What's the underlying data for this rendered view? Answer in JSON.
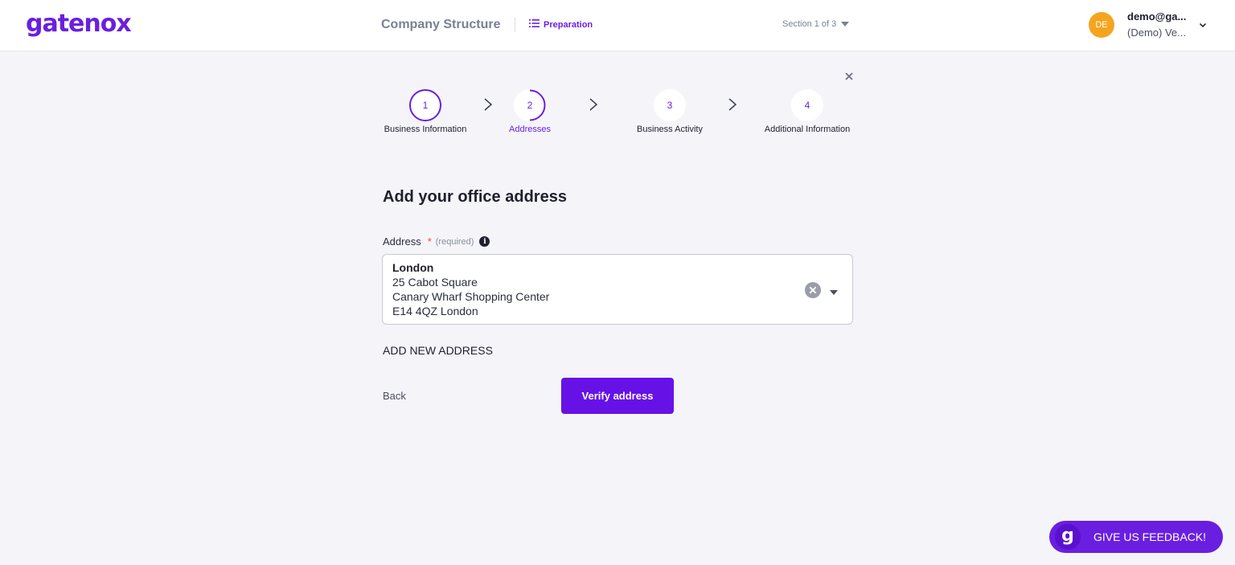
{
  "header": {
    "logo": "gatenox",
    "title": "Company Structure",
    "preparation_label": "Preparation",
    "section_label": "Section 1 of 3",
    "user": {
      "initials": "DE",
      "email": "demo@ga...",
      "org": "(Demo) Ve..."
    }
  },
  "stepper": {
    "steps": [
      {
        "number": "1",
        "label": "Business Information",
        "state": "completed"
      },
      {
        "number": "2",
        "label": "Addresses",
        "state": "active"
      },
      {
        "number": "3",
        "label": "Business Activity",
        "state": "upcoming"
      },
      {
        "number": "4",
        "label": "Additional Information",
        "state": "upcoming"
      }
    ]
  },
  "form": {
    "heading": "Add your office address",
    "address_label": "Address",
    "required_star": "*",
    "required_text": "(required)",
    "info_icon": "i",
    "selected_address": {
      "city": "London",
      "line1": "25 Cabot Square",
      "line2": "Canary Wharf Shopping Center",
      "line3": "E14 4QZ London"
    },
    "add_new_label": "ADD NEW ADDRESS",
    "back_label": "Back",
    "verify_label": "Verify address"
  },
  "feedback": {
    "logo_letter": "g",
    "label": "GIVE US FEEDBACK!"
  },
  "colors": {
    "brand": "#6a1fe0",
    "primary_button": "#6612e6",
    "avatar": "#f5a41f",
    "background": "#f5f5f9"
  }
}
